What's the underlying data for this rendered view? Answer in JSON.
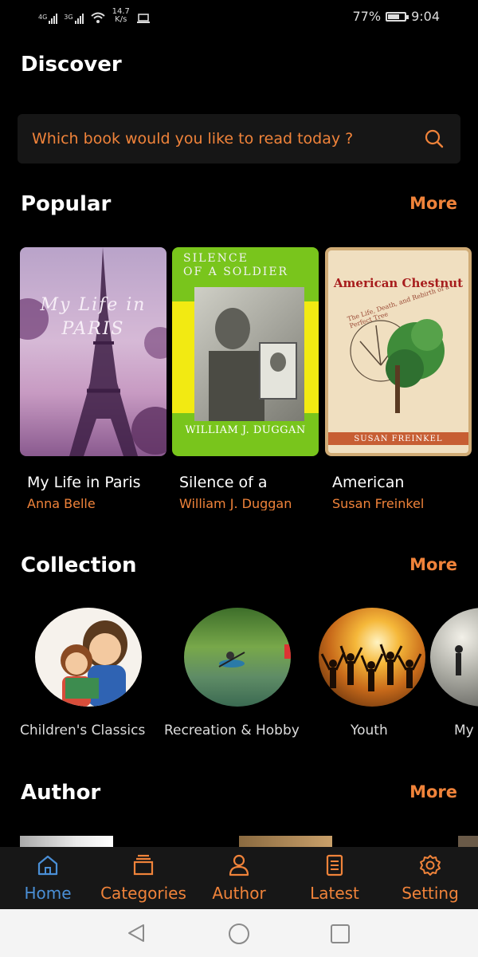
{
  "status": {
    "network1": "4G",
    "network2": "3G",
    "speed_value": "14.7",
    "speed_unit": "K/s",
    "battery": "77%",
    "battery_level": 0.77,
    "time": "9:04"
  },
  "page": {
    "title": "Discover"
  },
  "search": {
    "placeholder": "Which book would you like to read today ?"
  },
  "popular": {
    "title": "Popular",
    "more": "More",
    "books": [
      {
        "title": "My Life in Paris",
        "author": "Anna Belle",
        "cover_text_1": "My Life in",
        "cover_text_2": "PARIS"
      },
      {
        "title": "Silence of a",
        "author": "William J. Duggan",
        "cover_line1": "SILENCE",
        "cover_line2": "OF A SOLDIER",
        "cover_author": "WILLIAM J. DUGGAN"
      },
      {
        "title": "American",
        "author": "Susan Freinkel",
        "cover_title": "American Chestnut",
        "cover_subtitle": "The Life, Death, and Rebirth of a Perfect Tree",
        "cover_author": "SUSAN FREINKEL"
      }
    ]
  },
  "collection": {
    "title": "Collection",
    "more": "More",
    "items": [
      {
        "label": "Children's Classics"
      },
      {
        "label": "Recreation & Hobby"
      },
      {
        "label": "Youth"
      },
      {
        "label": "My"
      }
    ]
  },
  "author": {
    "title": "Author",
    "more": "More"
  },
  "nav": {
    "items": [
      {
        "label": "Home",
        "icon": "home-icon",
        "active": true
      },
      {
        "label": "Categories",
        "icon": "categories-icon",
        "active": false
      },
      {
        "label": "Author",
        "icon": "person-icon",
        "active": false
      },
      {
        "label": "Latest",
        "icon": "document-icon",
        "active": false
      },
      {
        "label": "Setting",
        "icon": "gear-icon",
        "active": false
      }
    ]
  },
  "colors": {
    "accent": "#f0833a",
    "active_nav": "#4a8fd6",
    "background": "#000000",
    "search_bg": "#161616",
    "nav_bg": "#171717"
  }
}
